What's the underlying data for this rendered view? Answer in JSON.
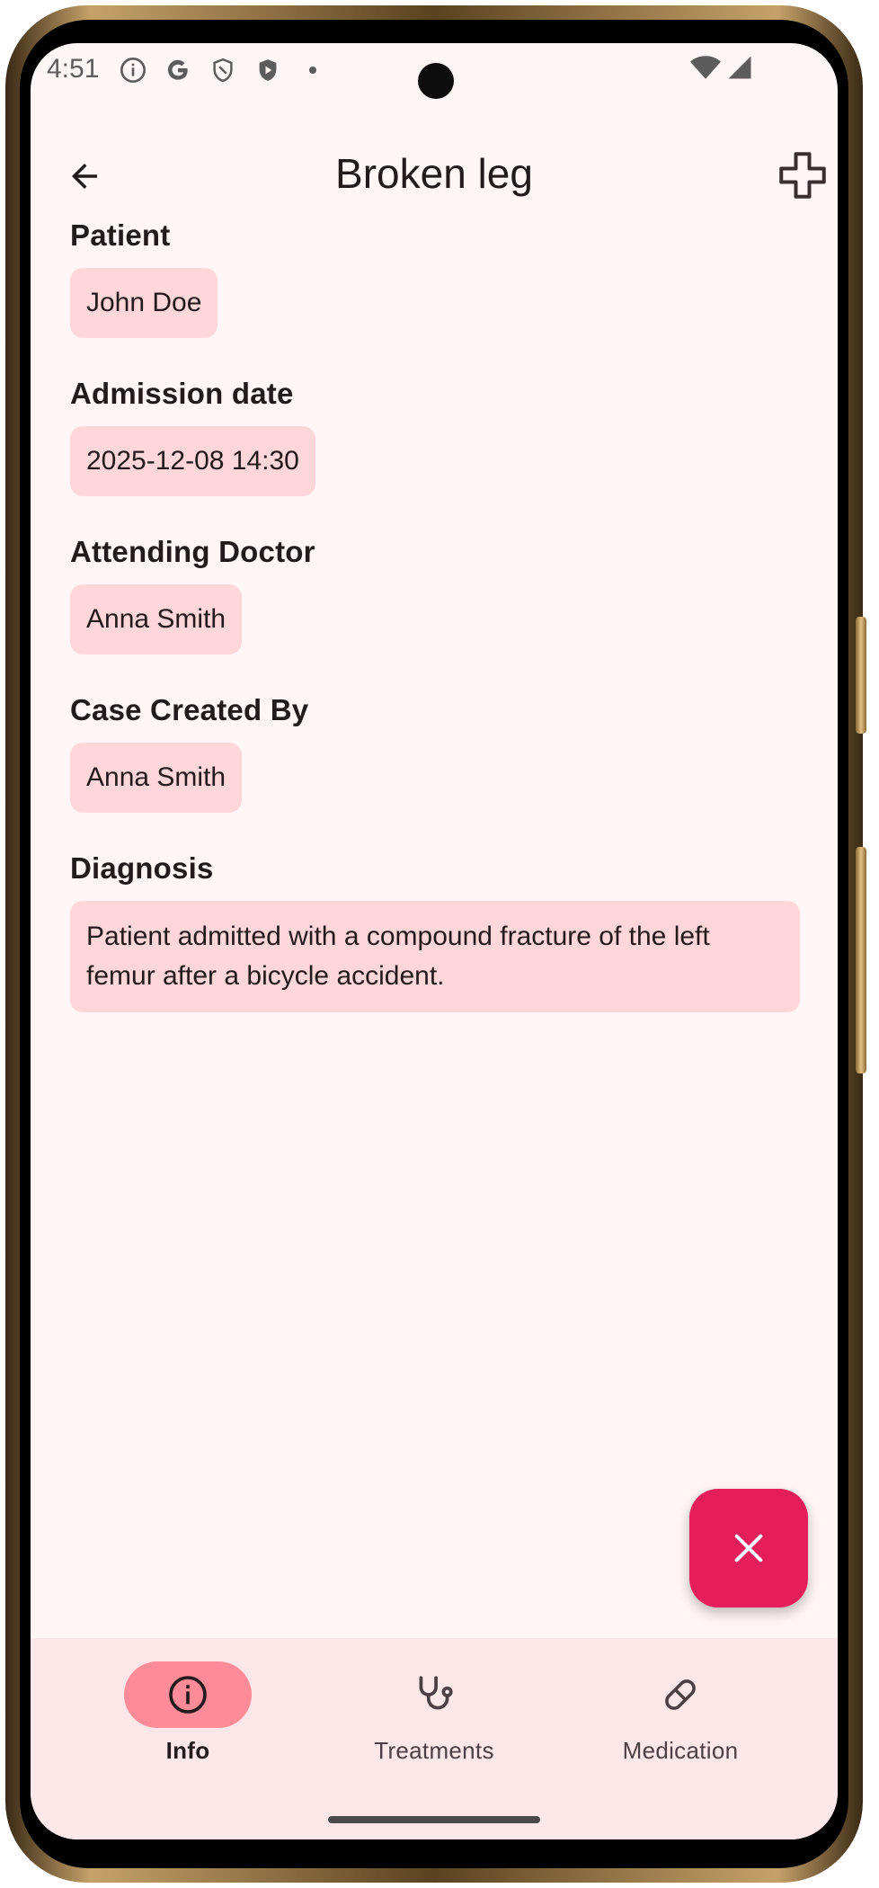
{
  "status_bar": {
    "time": "4:51",
    "icons": [
      "info-icon",
      "google-icon",
      "shield-icon",
      "play-protect-icon",
      "dot-icon",
      "wifi-icon",
      "signal-icon"
    ]
  },
  "app_bar": {
    "title": "Broken leg",
    "back_icon": "arrow-back-icon",
    "action_icon": "medical-cross-icon"
  },
  "fields": [
    {
      "label": "Patient",
      "value": "John Doe"
    },
    {
      "label": "Admission date",
      "value": "2025-12-08 14:30"
    },
    {
      "label": "Attending Doctor",
      "value": "Anna Smith"
    },
    {
      "label": "Case Created By",
      "value": "Anna Smith"
    },
    {
      "label": "Diagnosis",
      "value": "Patient admitted with a compound fracture of the left femur after a bicycle accident."
    }
  ],
  "fab": {
    "icon": "close-icon"
  },
  "bottom_nav": [
    {
      "label": "Info",
      "icon": "info-icon",
      "active": true
    },
    {
      "label": "Treatments",
      "icon": "stethoscope-icon",
      "active": false
    },
    {
      "label": "Medication",
      "icon": "pill-icon",
      "active": false
    }
  ],
  "colors": {
    "background": "#fff6f5",
    "chip": "#ffd6da",
    "fab": "#e31e5a",
    "nav_background": "#fee7e9",
    "nav_active_pill": "#ff8b98"
  }
}
